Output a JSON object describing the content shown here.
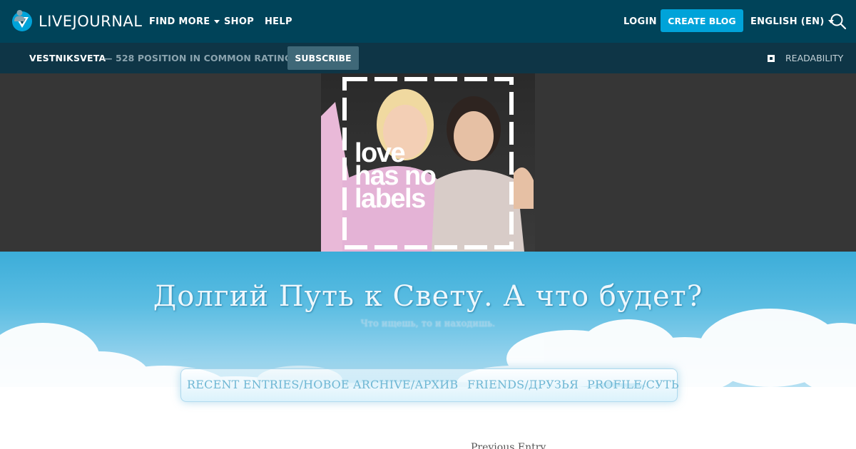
{
  "header": {
    "logo_text": "LIVEJOURNAL",
    "nav": {
      "find_more": "FIND MORE",
      "shop": "SHOP",
      "help": "HELP"
    },
    "login": "LOGIN",
    "create_blog": "CREATE BLOG",
    "language": "ENGLISH (EN)",
    "icons": {
      "logo": "livejournal-logo-icon",
      "search": "search-icon",
      "dropdown": "chevron-down-icon"
    },
    "colors": {
      "bar": "#004359",
      "accent": "#00a3d9"
    }
  },
  "journal_bar": {
    "username": "VESTNIKSVETA",
    "rating_text": "— 528 POSITION IN COMMON RATING",
    "subscribe": "SUBSCRIBE",
    "readability": "READABILITY",
    "colors": {
      "bar": "#0e3546",
      "subscribe_button": "#3f6878"
    }
  },
  "banner": {
    "image_text": "love has no labels",
    "description": "Two smiling girls in a dashed white frame"
  },
  "journal": {
    "title": "Долгий Путь к Свету. А что будет?",
    "subtitle": "Что ищешь, то и находишь."
  },
  "menu": {
    "items": [
      {
        "label": "RECENT ENTRIES/НОВОЕ"
      },
      {
        "label": "ARCHIVE/АРХИВ"
      },
      {
        "label": "FRIENDS/ДРУЗЬЯ"
      },
      {
        "label": "PROFILE/СУТЬ"
      }
    ]
  },
  "footer_partial": {
    "previous_entry": "Previous Entry"
  }
}
